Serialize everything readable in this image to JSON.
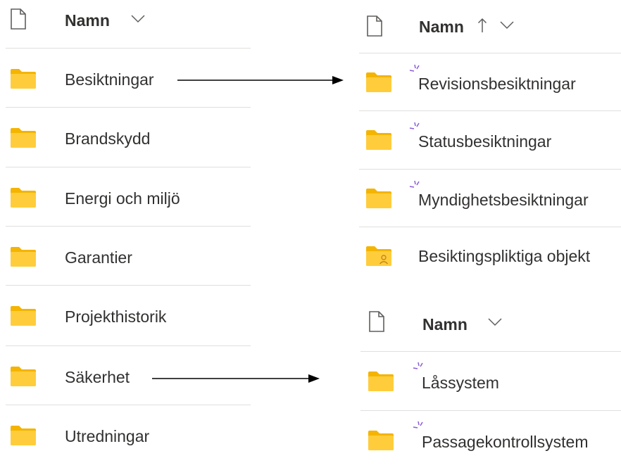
{
  "colors": {
    "folder_body": "#ffcd3c",
    "folder_tab": "#f4b400",
    "new_marker": "#8a5cd6",
    "divider": "#e1dfdd",
    "text": "#323130"
  },
  "icons": {
    "header_file": "file-icon",
    "folder": "folder-icon",
    "shared_folder": "shared-folder-icon",
    "new_item": "new-item-sparkle-icon",
    "sort_ascending": "arrow-up-icon",
    "sort_menu": "chevron-down-icon"
  },
  "left_list": {
    "header": {
      "title": "Namn"
    },
    "items": [
      {
        "label": "Besiktningar"
      },
      {
        "label": "Brandskydd"
      },
      {
        "label": "Energi och miljö"
      },
      {
        "label": "Garantier"
      },
      {
        "label": "Projekthistorik"
      },
      {
        "label": "Säkerhet"
      },
      {
        "label": "Utredningar"
      }
    ]
  },
  "right_top_list": {
    "header": {
      "title": "Namn",
      "sort": "ascending"
    },
    "items": [
      {
        "label": "Revisionsbesiktningar",
        "is_new": true
      },
      {
        "label": "Statusbesiktningar",
        "is_new": true
      },
      {
        "label": "Myndighetsbesiktningar",
        "is_new": true
      },
      {
        "label": "Besiktingspliktiga objekt",
        "shared": true
      }
    ]
  },
  "right_bottom_list": {
    "header": {
      "title": "Namn"
    },
    "items": [
      {
        "label": "Låssystem",
        "is_new": true
      },
      {
        "label": "Passagekontrollsystem",
        "is_new": true
      }
    ]
  }
}
